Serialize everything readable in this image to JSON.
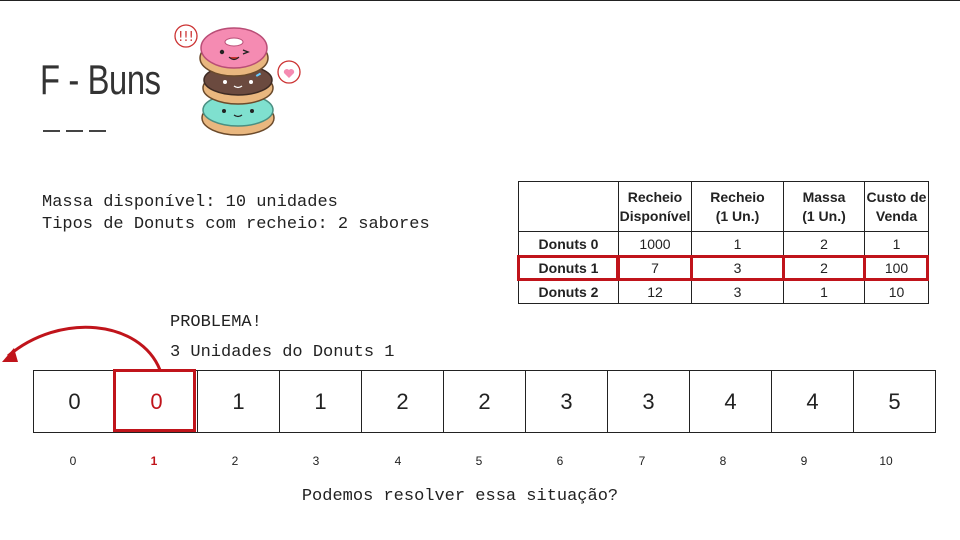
{
  "colors": {
    "accent": "#c0141b",
    "text": "#222222"
  },
  "slide": {
    "title": "F - Buns",
    "info_lines": [
      "Massa disponível: 10 unidades",
      "Tipos de Donuts com recheio: 2 sabores"
    ],
    "problem_lines": [
      "PROBLEMA!",
      "3 Unidades do Donuts 1"
    ],
    "question": "Podemos resolver essa situação?"
  },
  "table": {
    "headers": [
      "",
      [
        "Recheio",
        "Disponível"
      ],
      [
        "Recheio",
        "(1 Un.)"
      ],
      [
        "Massa",
        "(1 Un.)"
      ],
      [
        "Custo de",
        "Venda"
      ]
    ],
    "rows": [
      [
        "Donuts 0",
        "1000",
        "1",
        "2",
        "1"
      ],
      [
        "Donuts 1",
        "7",
        "3",
        "2",
        "100"
      ],
      [
        "Donuts 2",
        "12",
        "3",
        "1",
        "10"
      ]
    ],
    "highlighted_row": 1
  },
  "dp_array": {
    "values": [
      "0",
      "0",
      "1",
      "1",
      "2",
      "2",
      "3",
      "3",
      "4",
      "4",
      "5"
    ],
    "indices": [
      "0",
      "1",
      "2",
      "3",
      "4",
      "5",
      "6",
      "7",
      "8",
      "9",
      "10"
    ],
    "highlighted_index": 1
  }
}
